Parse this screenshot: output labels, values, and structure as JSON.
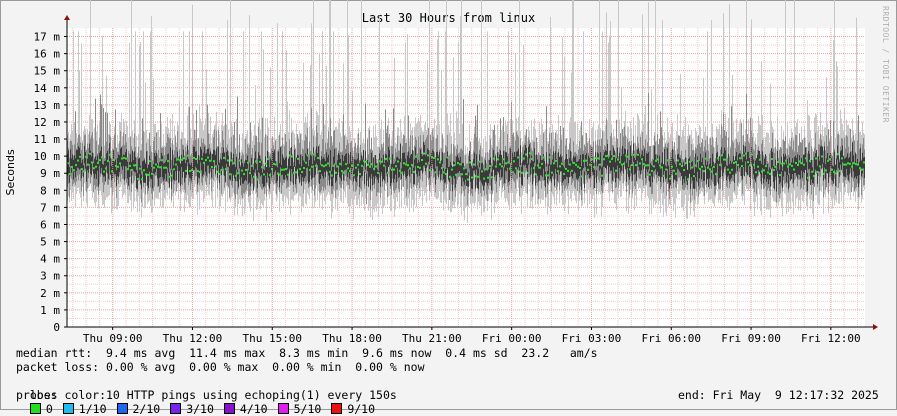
{
  "chart_data": {
    "type": "area",
    "title": "Last 30 Hours from linux",
    "ylabel": "Seconds",
    "y_ticks": [
      "0",
      "1 m",
      "2 m",
      "3 m",
      "4 m",
      "5 m",
      "6 m",
      "7 m",
      "8 m",
      "9 m",
      "10 m",
      "11 m",
      "12 m",
      "13 m",
      "14 m",
      "15 m",
      "16 m",
      "17 m"
    ],
    "ylim_ms": [
      0,
      17.5
    ],
    "x_ticks": [
      "Thu 09:00",
      "Thu 12:00",
      "Thu 15:00",
      "Thu 18:00",
      "Thu 21:00",
      "Fri 00:00",
      "Fri 03:00",
      "Fri 06:00",
      "Fri 09:00",
      "Fri 12:00"
    ],
    "x_range": [
      "Thu 07:17",
      "Fri 12:17"
    ],
    "series": [
      {
        "name": "median rtt",
        "approx_level_ms": 9.4,
        "color": "#33e033"
      }
    ],
    "grid": true
  },
  "watermark": "RRDTOOL / TOBI OETIKER",
  "stats": {
    "median": "median rtt:  9.4 ms avg  11.4 ms max  8.3 ms min  9.6 ms now  0.4 ms sd  23.2   am/s",
    "loss": "packet loss: 0.00 % avg  0.00 % max  0.00 % min  0.00 % now",
    "loss_color_label": "loss color:",
    "loss_colors": [
      {
        "label": "0",
        "color": "#22dd22"
      },
      {
        "label": "1/10",
        "color": "#22bbee"
      },
      {
        "label": "2/10",
        "color": "#2266ee"
      },
      {
        "label": "3/10",
        "color": "#7722ee"
      },
      {
        "label": "4/10",
        "color": "#8811cc"
      },
      {
        "label": "5/10",
        "color": "#dd22ee"
      },
      {
        "label": "9/10",
        "color": "#ee1111"
      }
    ],
    "probe": "probe:       10 HTTP pings using echoping(1) every 150s",
    "end": "end: Fri May  9 12:17:32 2025"
  }
}
